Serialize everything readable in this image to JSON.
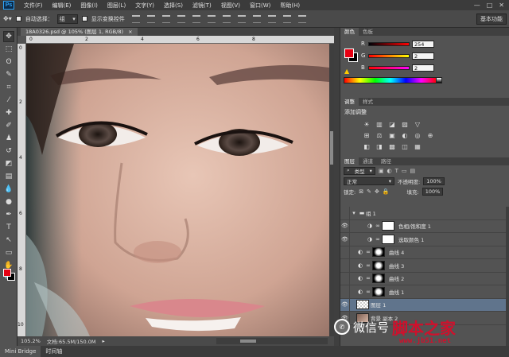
{
  "menubar": {
    "logo": "Ps",
    "items": [
      "文件(F)",
      "编辑(E)",
      "图像(I)",
      "图层(L)",
      "文字(Y)",
      "选择(S)",
      "滤镜(T)",
      "视图(V)",
      "窗口(W)",
      "帮助(H)"
    ],
    "window_controls": [
      "—",
      "□",
      "✕"
    ]
  },
  "options": {
    "auto_select_label": "自动选择：",
    "auto_select_value": "组",
    "show_transform_label": "显示变换控件",
    "workspace": "基本功能"
  },
  "document": {
    "tab_title": "18A0326.psd @ 105% (图层 1, RGB/8)",
    "tab_close": "×",
    "zoom": "105.2%",
    "doc_info": "文档:65.5M/150.0M",
    "ruler_top": [
      "0",
      "2",
      "4",
      "6",
      "8"
    ],
    "ruler_left": [
      "0",
      "2",
      "4",
      "6",
      "8",
      "10"
    ]
  },
  "tools": [
    {
      "name": "move-tool-icon",
      "glyph": "✥"
    },
    {
      "name": "marquee-tool-icon",
      "glyph": "⬚"
    },
    {
      "name": "lasso-tool-icon",
      "glyph": "ʘ"
    },
    {
      "name": "quick-select-tool-icon",
      "glyph": "✎"
    },
    {
      "name": "crop-tool-icon",
      "glyph": "⌗"
    },
    {
      "name": "eyedropper-tool-icon",
      "glyph": "⁄"
    },
    {
      "name": "healing-tool-icon",
      "glyph": "✚"
    },
    {
      "name": "brush-tool-icon",
      "glyph": "✐"
    },
    {
      "name": "stamp-tool-icon",
      "glyph": "♟"
    },
    {
      "name": "history-brush-tool-icon",
      "glyph": "↺"
    },
    {
      "name": "eraser-tool-icon",
      "glyph": "◩"
    },
    {
      "name": "gradient-tool-icon",
      "glyph": "▤"
    },
    {
      "name": "blur-tool-icon",
      "glyph": "💧"
    },
    {
      "name": "dodge-tool-icon",
      "glyph": "●"
    },
    {
      "name": "pen-tool-icon",
      "glyph": "✒"
    },
    {
      "name": "type-tool-icon",
      "glyph": "T"
    },
    {
      "name": "path-select-tool-icon",
      "glyph": "↖"
    },
    {
      "name": "shape-tool-icon",
      "glyph": "▭"
    },
    {
      "name": "hand-tool-icon",
      "glyph": "✋"
    },
    {
      "name": "zoom-tool-icon",
      "glyph": "🔍"
    }
  ],
  "bottom_tabs": [
    "Mini Bridge",
    "时间轴"
  ],
  "color_panel": {
    "tabs": [
      "颜色",
      "色板"
    ],
    "channels": [
      {
        "letter": "R",
        "value": "254",
        "fraction": 1.0
      },
      {
        "letter": "G",
        "value": "2",
        "fraction": 0.01
      },
      {
        "letter": "B",
        "value": "2",
        "fraction": 0.01
      }
    ],
    "fg_color": "#e60012",
    "bg_color": "#000000"
  },
  "adjustments_panel": {
    "tabs": [
      "调整",
      "样式"
    ],
    "title": "添加调整",
    "row1": [
      "☀",
      "▥",
      "◪",
      "▨",
      "▽"
    ],
    "row2": [
      "⊞",
      "⚖",
      "▣",
      "◐",
      "◎",
      "⊕"
    ],
    "row3": [
      "◧",
      "◨",
      "▩",
      "◫",
      "▦"
    ]
  },
  "layers_panel": {
    "tabs": [
      "图层",
      "通道",
      "路径"
    ],
    "filter_label": "类型",
    "blend_mode": "正常",
    "opacity_label": "不透明度:",
    "opacity_value": "100%",
    "lock_label": "锁定:",
    "fill_label": "填充:",
    "fill_value": "100%",
    "layers": [
      {
        "name": "组 1",
        "type": "group",
        "visible": false,
        "selected": false
      },
      {
        "name": "色相/饱和度 1",
        "type": "adjust",
        "visible": true,
        "selected": false
      },
      {
        "name": "选取颜色 1",
        "type": "adjust",
        "visible": true,
        "selected": false
      },
      {
        "name": "曲线 4",
        "type": "curve",
        "visible": false,
        "selected": false
      },
      {
        "name": "曲线 3",
        "type": "curve",
        "visible": false,
        "selected": false
      },
      {
        "name": "曲线 2",
        "type": "curve",
        "visible": false,
        "selected": false
      },
      {
        "name": "曲线 1",
        "type": "curve",
        "visible": false,
        "selected": false
      },
      {
        "name": "图层 1",
        "type": "pixel",
        "visible": true,
        "selected": true
      },
      {
        "name": "背景 副本 2",
        "type": "pixel",
        "visible": true,
        "selected": false
      }
    ]
  },
  "watermark": {
    "logo": "✆",
    "text": "微信号",
    "brand": "脚本之家",
    "url": "www.jb51.net"
  }
}
